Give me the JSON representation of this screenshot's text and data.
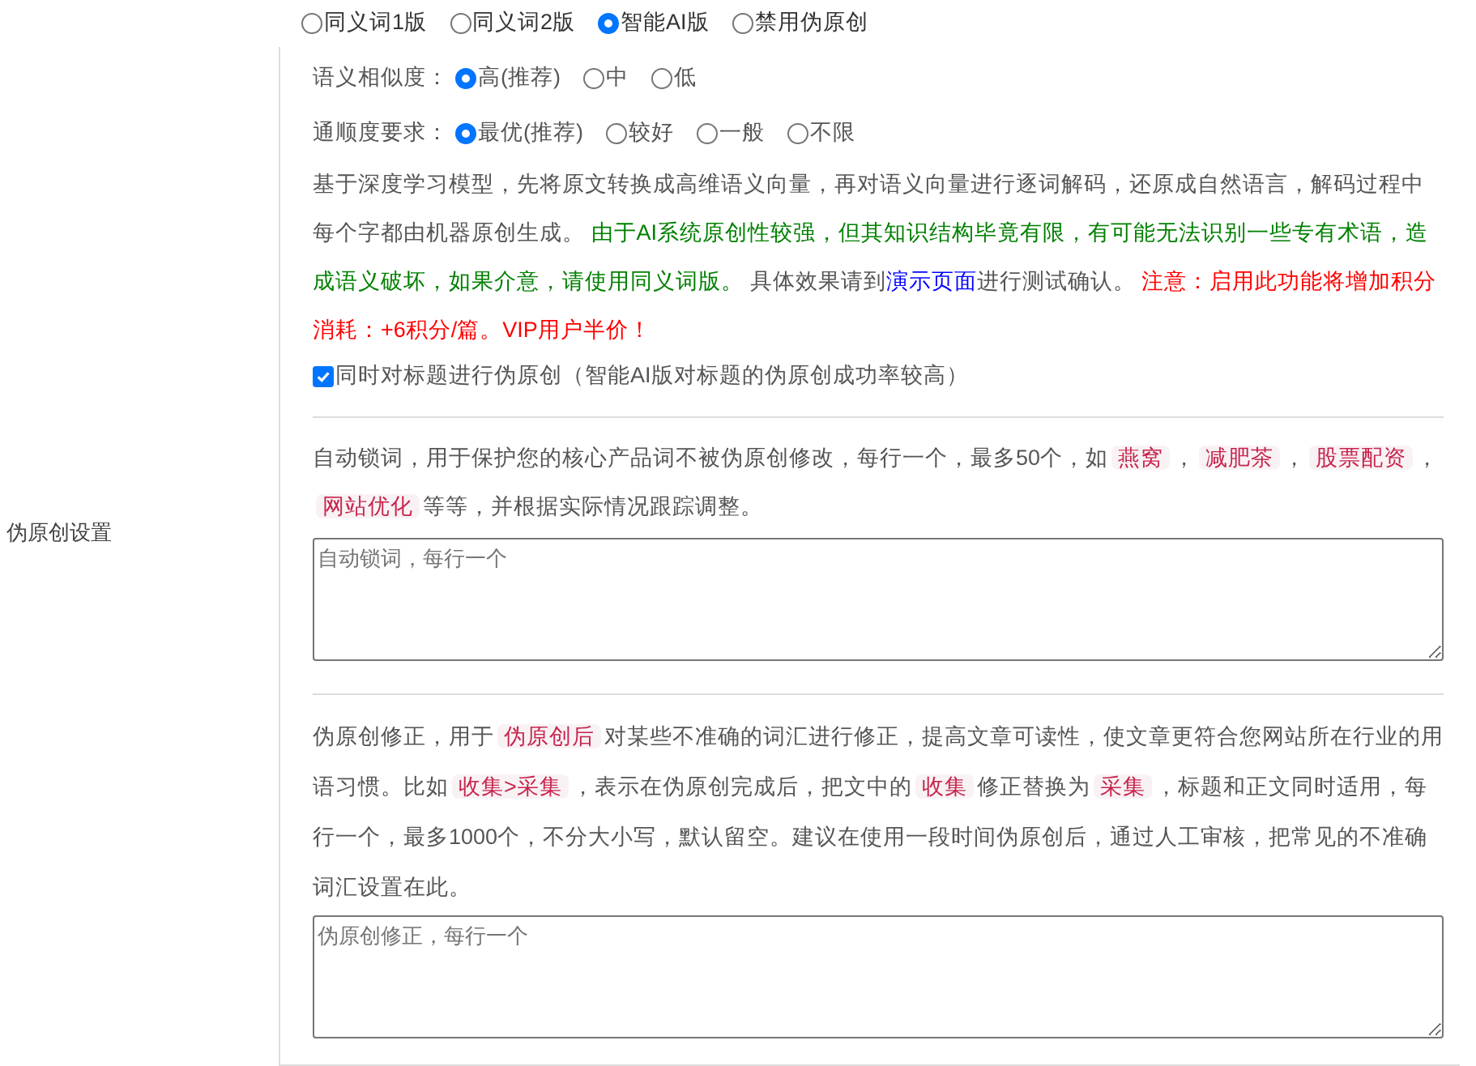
{
  "label": "伪原创设置",
  "modes": [
    {
      "label": "同义词1版",
      "selected": false
    },
    {
      "label": "同义词2版",
      "selected": false
    },
    {
      "label": "智能AI版",
      "selected": true
    },
    {
      "label": "禁用伪原创",
      "selected": false
    }
  ],
  "similarity": {
    "label": "语义相似度：",
    "options": [
      {
        "label": "高(推荐)",
        "selected": true
      },
      {
        "label": "中",
        "selected": false
      },
      {
        "label": "低",
        "selected": false
      }
    ]
  },
  "fluency": {
    "label": "通顺度要求：",
    "options": [
      {
        "label": "最优(推荐)",
        "selected": true
      },
      {
        "label": "较好",
        "selected": false
      },
      {
        "label": "一般",
        "selected": false
      },
      {
        "label": "不限",
        "selected": false
      }
    ]
  },
  "ai_description": [
    {
      "kind": "text",
      "text": "基于深度学习模型，先将原文转换成高维语义向量，再对语义向量进行逐词解码，还原成自然语言，解码过程中每个字都由机器原创生成。 "
    },
    {
      "kind": "green",
      "text": "由于AI系统原创性较强，但其知识结构毕竟有限，有可能无法识别一些专有术语，造成语义破坏，如果介意，请使用同义词版。"
    },
    {
      "kind": "text",
      "text": " 具体效果请到"
    },
    {
      "kind": "link",
      "text": "演示页面"
    },
    {
      "kind": "text",
      "text": "进行测试确认。 "
    },
    {
      "kind": "red",
      "text": "注意：启用此功能将增加积分消耗：+6积分/篇。VIP用户半价！"
    }
  ],
  "title_option": {
    "label": "同时对标题进行伪原创（智能AI版对标题的伪原创成功率较高）",
    "checked": true
  },
  "lock_description": [
    {
      "kind": "text",
      "text": "自动锁词，用于保护您的核心产品词不被伪原创修改，每行一个，最多50个，如"
    },
    {
      "kind": "tag",
      "text": "燕窝"
    },
    {
      "kind": "text",
      "text": "，"
    },
    {
      "kind": "tag",
      "text": "减肥茶"
    },
    {
      "kind": "text",
      "text": "，"
    },
    {
      "kind": "tag",
      "text": "股票配资"
    },
    {
      "kind": "text",
      "text": "，"
    },
    {
      "kind": "tag",
      "text": "网站优化"
    },
    {
      "kind": "text",
      "text": "等等，并根据实际情况跟踪调整。"
    }
  ],
  "lock_field": {
    "placeholder": "自动锁词，每行一个"
  },
  "fix_description": [
    {
      "kind": "text",
      "text": "伪原创修正，用于"
    },
    {
      "kind": "tag",
      "text": "伪原创后"
    },
    {
      "kind": "text",
      "text": "对某些不准确的词汇进行修正，提高文章可读性，使文章更符合您网站所在行业的用语习惯。比如"
    },
    {
      "kind": "tag",
      "text": "收集>采集"
    },
    {
      "kind": "text",
      "text": "，表示在伪原创完成后，把文中的"
    },
    {
      "kind": "tag",
      "text": "收集"
    },
    {
      "kind": "text",
      "text": "修正替换为"
    },
    {
      "kind": "tag",
      "text": "采集"
    },
    {
      "kind": "text",
      "text": "，标题和正文同时适用，每行一个，最多1000个，不分大小写，默认留空。建议在使用一段时间伪原创后，通过人工审核，把常见的不准确词汇设置在此。"
    }
  ],
  "fix_field": {
    "placeholder": "伪原创修正，每行一个"
  }
}
